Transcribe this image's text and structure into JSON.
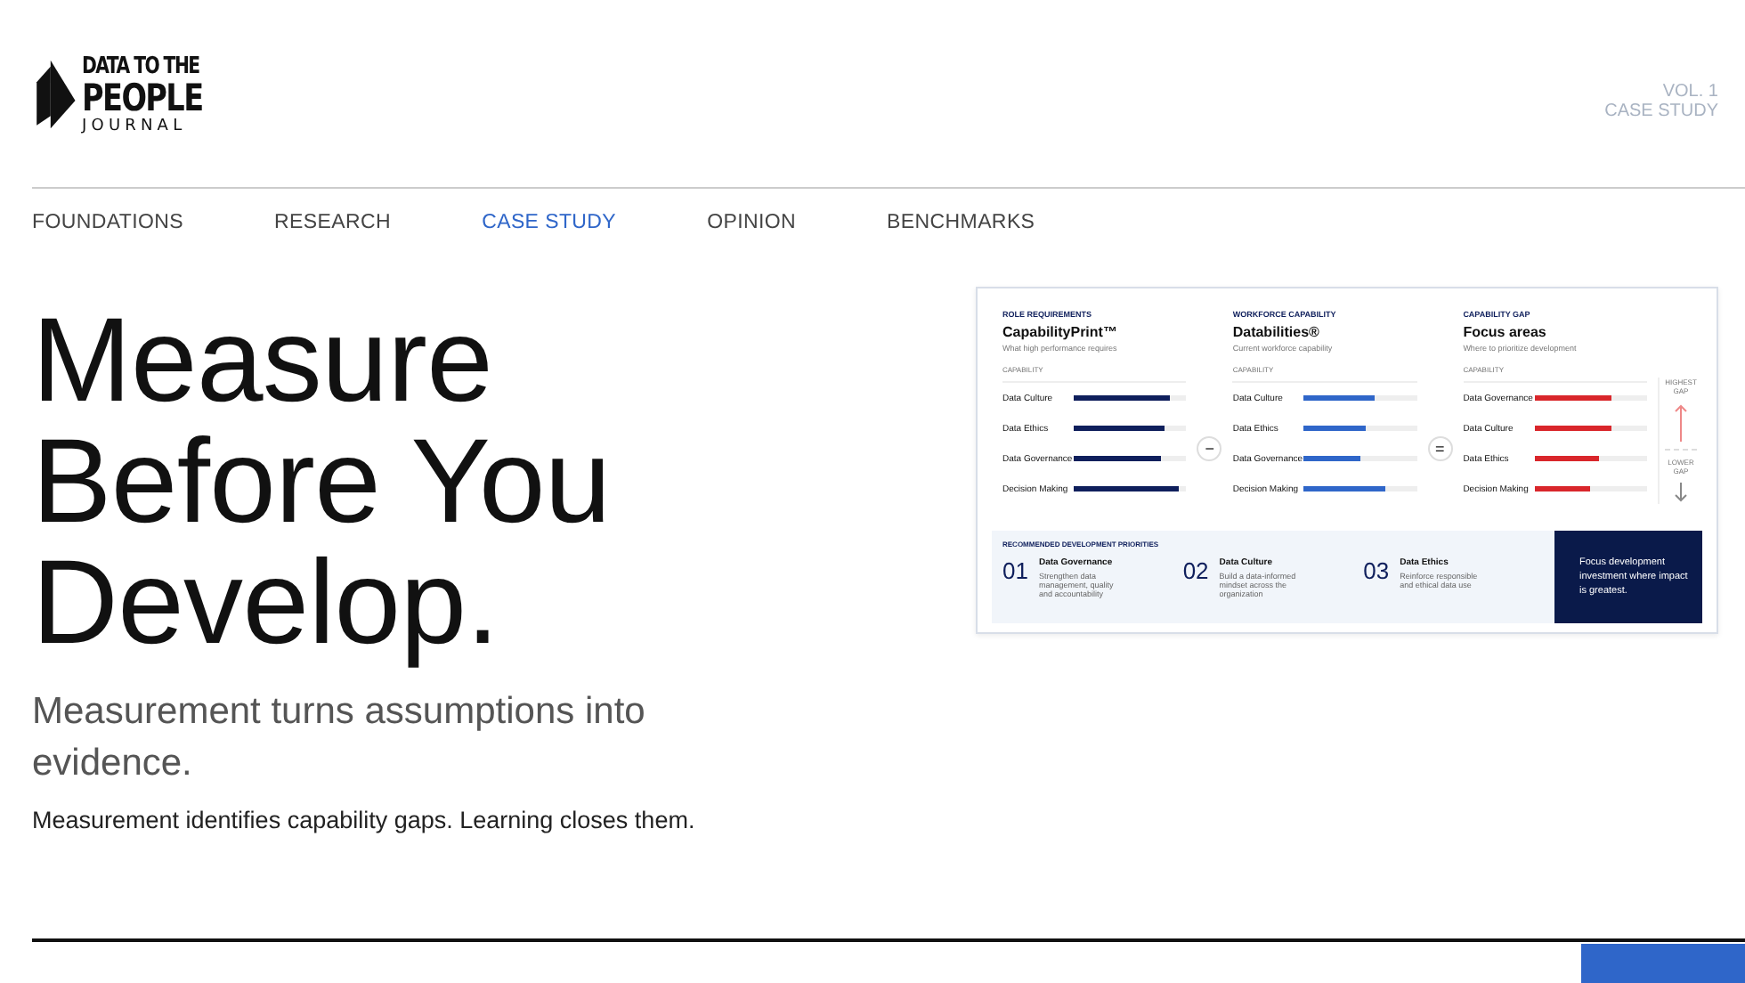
{
  "logo": {
    "line_1": "DATA TO THE",
    "line_2": "PEOPLE",
    "line_3": "JOURNAL"
  },
  "issue": {
    "volume": "VOL. 1",
    "section": "CASE STUDY"
  },
  "nav": [
    {
      "label": "FOUNDATIONS",
      "selected": false
    },
    {
      "label": "RESEARCH",
      "selected": false
    },
    {
      "label": "CASE STUDY",
      "selected": true
    },
    {
      "label": "OPINION",
      "selected": false
    },
    {
      "label": "BENCHMARKS",
      "selected": false
    }
  ],
  "hero": {
    "title_lines": [
      "Measure",
      "Before You",
      "Develop."
    ],
    "subtitle": "Measurement turns assumptions into evidence.",
    "tagline": "Measurement identifies capability gaps. Learning closes them."
  },
  "diagram": {
    "panels": [
      {
        "kind": "required",
        "eyebrow": "ROLE REQUIREMENTS",
        "title": "CapabilityPrint™",
        "subtitle": "What high performance requires",
        "column_label": "CAPABILITY",
        "operator": "−",
        "rows": [
          {
            "label": "Data Culture",
            "level": 0.85
          },
          {
            "label": "Data Ethics",
            "level": 0.8
          },
          {
            "label": "Data Governance",
            "level": 0.77
          },
          {
            "label": "Decision Making",
            "level": 0.93
          }
        ]
      },
      {
        "kind": "current",
        "eyebrow": "WORKFORCE CAPABILITY",
        "title": "Databilities®",
        "subtitle": "Current workforce capability",
        "column_label": "CAPABILITY",
        "operator": "=",
        "rows": [
          {
            "label": "Data Culture",
            "level": 0.62
          },
          {
            "label": "Data Ethics",
            "level": 0.55
          },
          {
            "label": "Data Governance",
            "level": 0.5
          },
          {
            "label": "Decision Making",
            "level": 0.72
          }
        ]
      },
      {
        "kind": "gap",
        "eyebrow": "CAPABILITY GAP",
        "title": "Focus areas",
        "subtitle": "Where to prioritize development",
        "column_label": "CAPABILITY",
        "rows": [
          {
            "label": "Data Governance",
            "level": 0.68
          },
          {
            "label": "Data Culture",
            "level": 0.68
          },
          {
            "label": "Data Ethics",
            "level": 0.58
          },
          {
            "label": "Decision Making",
            "level": 0.5
          }
        ]
      }
    ],
    "gap_scale": {
      "top": "HIGHEST GAP",
      "bottom": "LOWER GAP"
    },
    "priorities": {
      "label": "RECOMMENDED DEVELOPMENT PRIORITIES",
      "items": [
        {
          "number": "01",
          "title": "Data Governance",
          "text": "Strengthen data management, quality and accountability"
        },
        {
          "number": "02",
          "title": "Data Culture",
          "text": "Build a data-informed mindset across the organization"
        },
        {
          "number": "03",
          "title": "Data Ethics",
          "text": "Reinforce responsible and ethical data use"
        }
      ],
      "callout": "Focus development investment where impact is greatest."
    }
  }
}
